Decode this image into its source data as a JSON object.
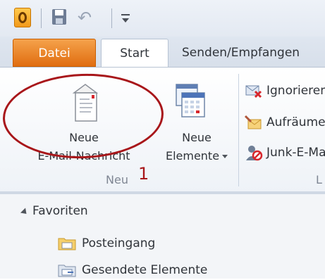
{
  "qat": {
    "icons": [
      "outlook-logo-icon",
      "save-icon",
      "undo-icon",
      "customize-qat-icon"
    ]
  },
  "tabs": {
    "datei": "Datei",
    "start": "Start",
    "senden": "Senden/Empfangen"
  },
  "ribbon": {
    "new_email": {
      "line1": "Neue",
      "line2": "E-Mail-Nachricht"
    },
    "new_items": {
      "line1": "Neue",
      "line2": "Elemente"
    },
    "group_neu": "Neu",
    "small_buttons": {
      "ignore": "Ignorieren",
      "cleanup": "Aufräumen",
      "junk": "Junk-E-Mail"
    },
    "group_l": "L"
  },
  "annotation": {
    "number": "1",
    "color": "#a8161a"
  },
  "nav": {
    "favorites": "Favoriten",
    "folders": [
      "Posteingang",
      "Gesendete Elemente"
    ]
  },
  "colors": {
    "datei_tab": "#e8801e",
    "accent": "#a8161a"
  }
}
